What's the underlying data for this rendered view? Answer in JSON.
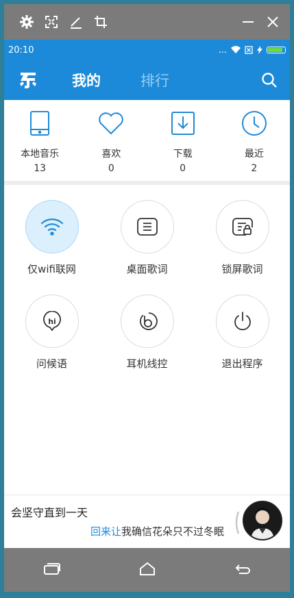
{
  "status_bar": {
    "time": "20:10",
    "dots": "...",
    "battery_color": "#6bdc3c",
    "battery_level": 0.9
  },
  "colors": {
    "accent": "#1c8ad8",
    "inactive_tab": "#9ccdf2",
    "wifi_on_bg": "#dbeffd"
  },
  "app_bar": {
    "tabs": [
      {
        "label": "我的",
        "active": true
      },
      {
        "label": "排行",
        "active": false
      }
    ]
  },
  "quick_access": [
    {
      "label": "本地音乐",
      "count": "13",
      "icon": "phone-icon"
    },
    {
      "label": "喜欢",
      "count": "0",
      "icon": "heart-icon"
    },
    {
      "label": "下载",
      "count": "0",
      "icon": "download-icon"
    },
    {
      "label": "最近",
      "count": "2",
      "icon": "clock-icon"
    }
  ],
  "features": [
    {
      "label": "仅wifi联网",
      "icon": "wifi-icon",
      "active": true
    },
    {
      "label": "桌面歌词",
      "icon": "lyrics-icon",
      "active": false
    },
    {
      "label": "锁屏歌词",
      "icon": "lock-lyrics-icon",
      "active": false
    },
    {
      "label": "问候语",
      "icon": "greeting-icon",
      "active": false
    },
    {
      "label": "耳机线控",
      "icon": "headset-icon",
      "active": false
    },
    {
      "label": "退出程序",
      "icon": "power-icon",
      "active": false
    }
  ],
  "player": {
    "line1": "会坚守直到一天",
    "line2_highlight": "回来让",
    "line2_rest": "我确信花朵只不过冬眠"
  }
}
